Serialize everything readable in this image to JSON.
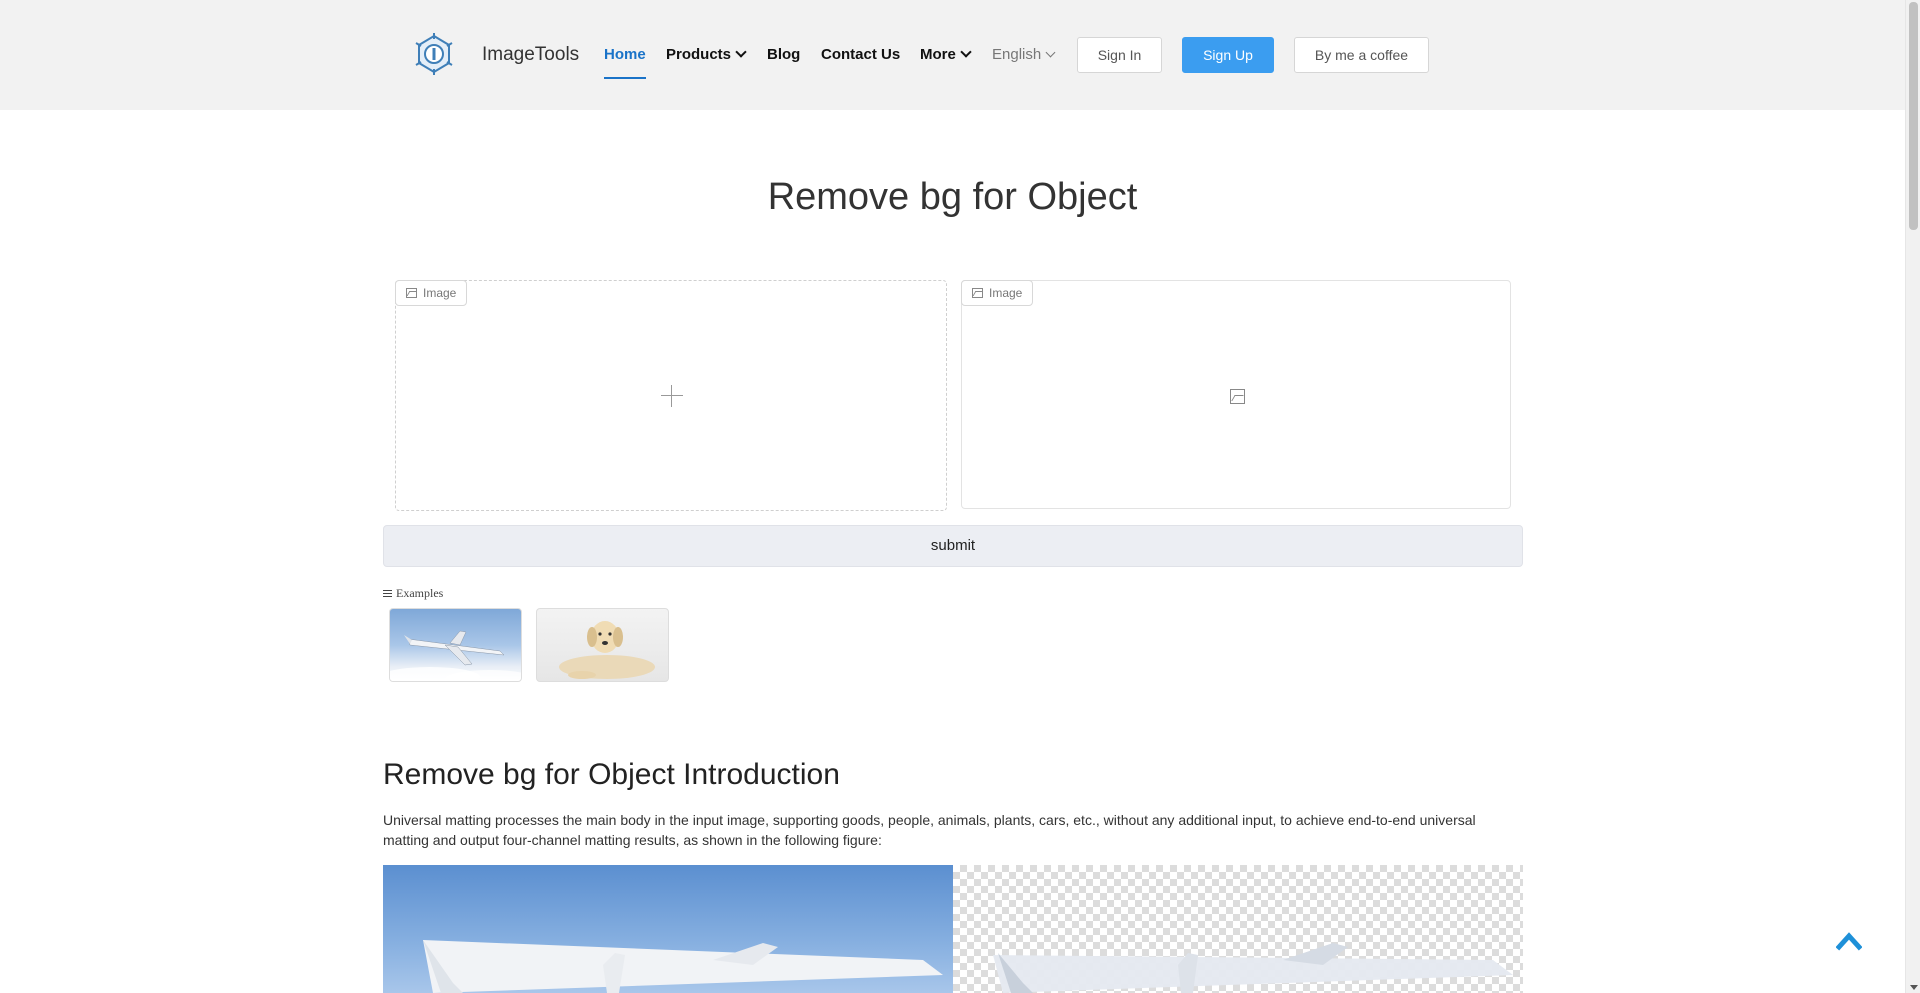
{
  "header": {
    "brand": "ImageTools",
    "nav": {
      "home": "Home",
      "products": "Products",
      "blog": "Blog",
      "contact": "Contact Us",
      "more": "More"
    },
    "language": "English",
    "sign_in": "Sign In",
    "sign_up": "Sign Up",
    "coffee": "By me a coffee"
  },
  "page_title": "Remove bg for Object",
  "input_panel": {
    "tag": "Image"
  },
  "output_panel": {
    "tag": "Image"
  },
  "submit_label": "submit",
  "examples": {
    "label": "Examples",
    "items": [
      "airplane",
      "dog"
    ]
  },
  "intro": {
    "title": "Remove bg for Object Introduction",
    "text": "Universal matting processes the main body in the input image, supporting goods, people, animals, plants, cars, etc., without any additional input, to achieve end-to-end universal matting and output four-channel matting results, as shown in the following figure:"
  },
  "colors": {
    "accent": "#1a73c8",
    "primary_button": "#3b9df0",
    "header_bg": "#f2f2f2",
    "back_to_top": "#1e90d8"
  },
  "icons": [
    "logo-icon",
    "chevron-down-icon",
    "image-icon",
    "plus-icon",
    "image-placeholder-icon",
    "menu-icon",
    "back-to-top-icon"
  ]
}
